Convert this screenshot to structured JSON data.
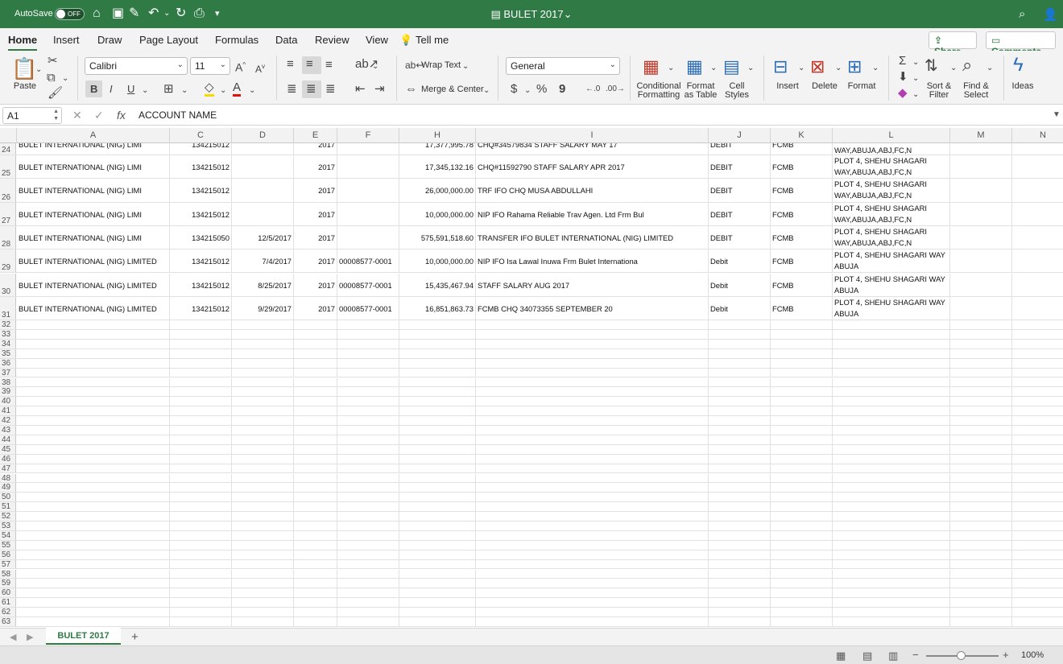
{
  "titlebar": {
    "autosave_label": "AutoSave",
    "autosave_state": "OFF",
    "doc_title": "BULET 2017",
    "chevron": "⌄"
  },
  "ribbon_tabs": [
    "Home",
    "Insert",
    "Draw",
    "Page Layout",
    "Formulas",
    "Data",
    "Review",
    "View"
  ],
  "tell_me": "Tell me",
  "share_label": "Share",
  "comments_label": "Comments",
  "ribbon": {
    "paste": "Paste",
    "font_name": "Calibri",
    "font_size": "11",
    "wrap_text": "Wrap Text",
    "merge_center": "Merge & Center",
    "number_format": "General",
    "conditional_1": "Conditional",
    "conditional_2": "Formatting",
    "format_table_1": "Format",
    "format_table_2": "as Table",
    "cell_styles_1": "Cell",
    "cell_styles_2": "Styles",
    "insert": "Insert",
    "delete": "Delete",
    "format": "Format",
    "sort_filter_1": "Sort &",
    "sort_filter_2": "Filter",
    "find_select_1": "Find &",
    "find_select_2": "Select",
    "ideas": "Ideas",
    "bold": "B",
    "italic": "I",
    "underline": "U",
    "font_grow": "A",
    "font_shrink": "A",
    "currency": "$",
    "percent": "%",
    "comma": "9"
  },
  "formula_bar": {
    "cell_ref": "A1",
    "fx": "fx",
    "formula": "ACCOUNT NAME"
  },
  "column_headers": [
    "A",
    "C",
    "D",
    "E",
    "F",
    "H",
    "I",
    "J",
    "K",
    "L",
    "M",
    "N"
  ],
  "data_rows": [
    {
      "num": "24",
      "A": "BULET INTERNATIONAL (NIG) LIMI",
      "C": "134215012",
      "D": "",
      "E": "2017",
      "F": "",
      "H": "17,377,995.78",
      "I": "CHQ#34579834 STAFF SALARY MAY 17",
      "J": "DEBIT",
      "K": "FCMB",
      "L": "WAY,ABUJA,ABJ,FC,N"
    },
    {
      "num": "25",
      "A": "BULET INTERNATIONAL (NIG) LIMI",
      "C": "134215012",
      "D": "",
      "E": "2017",
      "F": "",
      "H": "17,345,132.16",
      "I": "CHQ#11592790 STAFF SALARY APR 2017",
      "J": "DEBIT",
      "K": "FCMB",
      "L": "PLOT 4, SHEHU SHAGARI WAY,ABUJA,ABJ,FC,N"
    },
    {
      "num": "26",
      "A": "BULET INTERNATIONAL (NIG) LIMI",
      "C": "134215012",
      "D": "",
      "E": "2017",
      "F": "",
      "H": "26,000,000.00",
      "I": "TRF IFO CHQ MUSA ABDULLAHI",
      "J": "DEBIT",
      "K": "FCMB",
      "L": "PLOT 4, SHEHU SHAGARI WAY,ABUJA,ABJ,FC,N"
    },
    {
      "num": "27",
      "A": "BULET INTERNATIONAL (NIG) LIMI",
      "C": "134215012",
      "D": "",
      "E": "2017",
      "F": "",
      "H": "10,000,000.00",
      "I": "NIP IFO Rahama Reliable Trav Agen. Ltd Frm Bul",
      "J": "DEBIT",
      "K": "FCMB",
      "L": "PLOT 4, SHEHU SHAGARI WAY,ABUJA,ABJ,FC,N"
    },
    {
      "num": "28",
      "A": "BULET INTERNATIONAL (NIG) LIMI",
      "C": "134215050",
      "D": "12/5/2017",
      "E": "2017",
      "F": "",
      "H": "575,591,518.60",
      "I": "TRANSFER IFO BULET INTERNATIONAL (NIG) LIMITED",
      "J": "DEBIT",
      "K": "FCMB",
      "L": "PLOT 4, SHEHU SHAGARI WAY,ABUJA,ABJ,FC,N"
    },
    {
      "num": "29",
      "A": "BULET INTERNATIONAL (NIG) LIMITED",
      "C": "134215012",
      "D": "7/4/2017",
      "E": "2017",
      "F": "00008577-0001",
      "H": "10,000,000.00",
      "I": "NIP IFO Isa Lawal Inuwa Frm Bulet Internationa",
      "J": "Debit",
      "K": "FCMB",
      "L": "PLOT 4, SHEHU SHAGARI WAY ABUJA"
    },
    {
      "num": "30",
      "A": "BULET INTERNATIONAL (NIG) LIMITED",
      "C": "134215012",
      "D": "8/25/2017",
      "E": "2017",
      "F": "00008577-0001",
      "H": "15,435,467.94",
      "I": "STAFF SALARY AUG 2017",
      "J": "Debit",
      "K": "FCMB",
      "L": "PLOT 4, SHEHU SHAGARI WAY ABUJA"
    },
    {
      "num": "31",
      "A": "BULET INTERNATIONAL (NIG) LIMITED",
      "C": "134215012",
      "D": "9/29/2017",
      "E": "2017",
      "F": "00008577-0001",
      "H": "16,851,863.73",
      "I": "FCMB CHQ 34073355 SEPTEMBER 20",
      "J": "Debit",
      "K": "FCMB",
      "L": "PLOT 4, SHEHU SHAGARI WAY ABUJA"
    }
  ],
  "empty_rows": [
    "32",
    "33",
    "34",
    "35",
    "36",
    "37",
    "38",
    "39",
    "40",
    "41",
    "42",
    "43",
    "44",
    "45",
    "46",
    "47",
    "48",
    "49",
    "50",
    "51",
    "52",
    "53",
    "54",
    "55",
    "56",
    "57",
    "58",
    "59",
    "60",
    "61",
    "62",
    "63"
  ],
  "sheet_tab": "BULET 2017",
  "zoom_level": "100%",
  "colors": {
    "accent": "#2f7a45",
    "ribbon_bg": "#f3f3f3",
    "grid_line": "#e1e1e1"
  }
}
